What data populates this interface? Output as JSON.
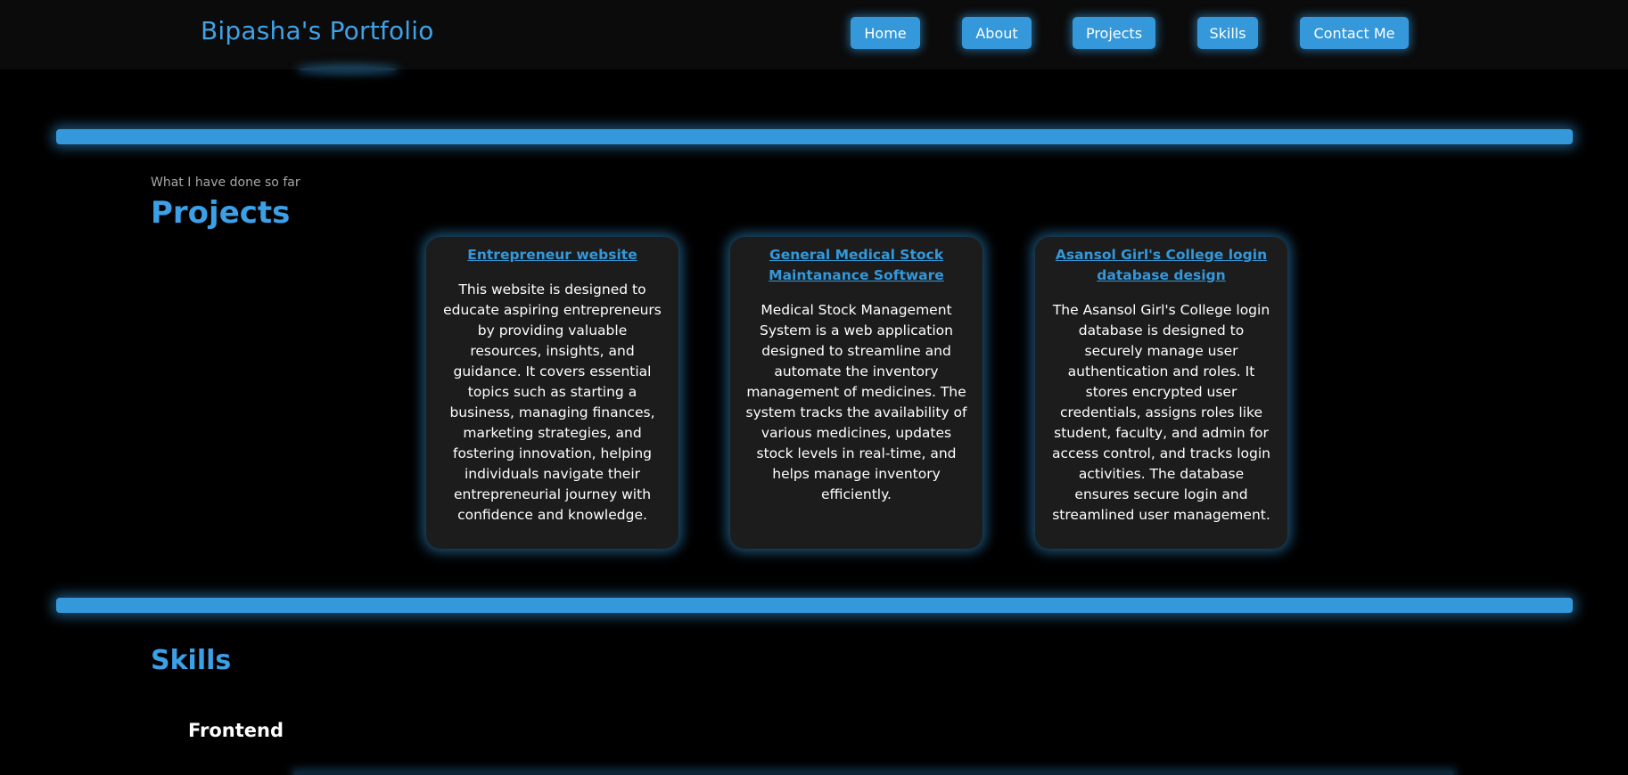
{
  "header": {
    "brand": "Bipasha's Portfolio",
    "nav": [
      {
        "label": "Home"
      },
      {
        "label": "About"
      },
      {
        "label": "Projects"
      },
      {
        "label": "Skills"
      },
      {
        "label": "Contact Me"
      }
    ]
  },
  "projects": {
    "eyebrow": "What I have done so far",
    "title": "Projects",
    "cards": [
      {
        "title": "Entrepreneur website",
        "description": "This website is designed to educate aspiring entrepreneurs by providing valuable resources, insights, and guidance. It covers essential topics such as starting a business, managing finances, marketing strategies, and fostering innovation, helping individuals navigate their entrepreneurial journey with confidence and knowledge."
      },
      {
        "title": "General Medical Stock Maintanance Software",
        "description": "Medical Stock Management System is a web application designed to streamline and automate the inventory management of medicines. The system tracks the availability of various medicines, updates stock levels in real-time, and helps manage inventory efficiently."
      },
      {
        "title": "Asansol Girl's College login database design",
        "description": "The Asansol Girl's College login database is designed to securely manage user authentication and roles. It stores encrypted user credentials, assigns roles like student, faculty, and admin for access control, and tracks login activities. The database ensures secure login and streamlined user management."
      }
    ]
  },
  "skills": {
    "title": "Skills",
    "subsection": "Frontend"
  },
  "colors": {
    "accent": "#3498db",
    "background": "#000000",
    "card": "#1c1c1c"
  }
}
